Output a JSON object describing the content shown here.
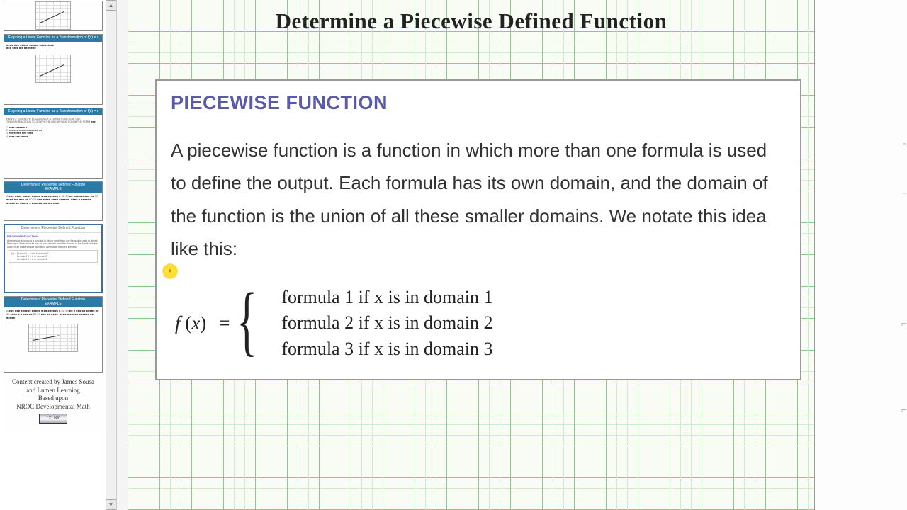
{
  "slide": {
    "title": "Determine a Piecewise Defined Function",
    "box_heading": "PIECEWISE FUNCTION",
    "box_text": "A piecewise function is a function in which more than one formula is used to define the output. Each formula has its own domain, and the domain of the function is the union of all these smaller domains. We notate this idea like this:",
    "fx": "f (x)",
    "eq": "=",
    "case1": "formula 1 if x is in domain 1",
    "case2": "formula 2 if x is in domain 2",
    "case3": "formula 3 if x is in domain 3"
  },
  "credits": {
    "line1": "Content created by James Sousa",
    "line2": "and Lumen Learning",
    "line3": "Based upon",
    "line4": "NROC Developmental Math",
    "cc": "CC BY"
  },
  "scroll": {
    "up": "▴",
    "down": "▾"
  },
  "marker": "✦"
}
